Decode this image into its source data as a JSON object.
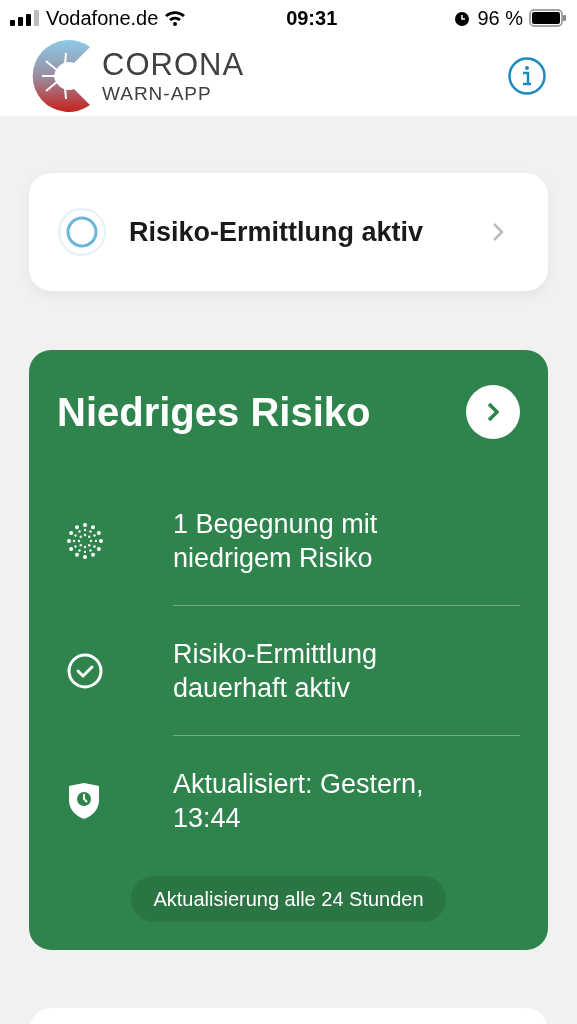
{
  "status_bar": {
    "carrier": "Vodafone.de",
    "time": "09:31",
    "battery": "96 %"
  },
  "header": {
    "logo_title": "CORONA",
    "logo_subtitle": "WARN-APP"
  },
  "tracing_card": {
    "label": "Risiko-Ermittlung aktiv"
  },
  "risk_card": {
    "title": "Niedriges Risiko",
    "items": [
      {
        "kind": "encounters",
        "text": "1 Begegnung mit niedrigem Risiko"
      },
      {
        "kind": "check",
        "text": "Risiko-Ermittlung dauerhaft aktiv"
      },
      {
        "kind": "shield",
        "text": "Aktualisiert: Gestern, 13:44"
      }
    ],
    "footer": "Aktualisierung alle 24 Stunden"
  }
}
